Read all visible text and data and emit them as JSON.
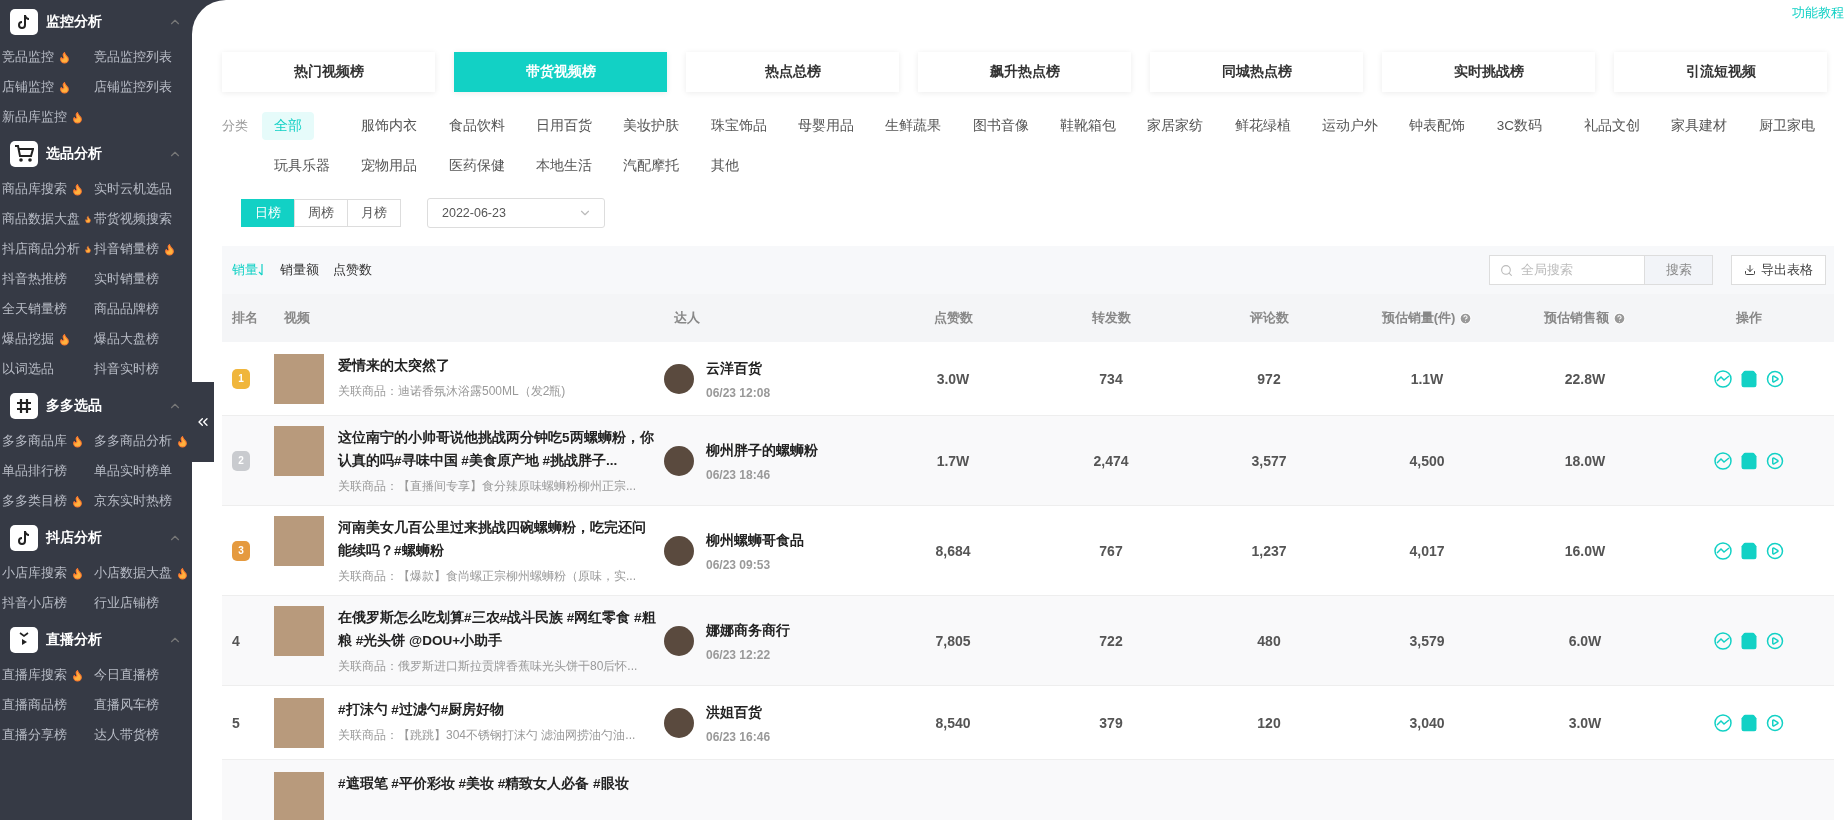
{
  "sidebar": {
    "sections": [
      {
        "title": "监控分析",
        "kind": "tiktok",
        "expanded": true,
        "items": [
          {
            "label": "竞品监控",
            "hot": true
          },
          {
            "label": "竞品监控列表",
            "hot": false
          },
          {
            "label": "店铺监控",
            "hot": true
          },
          {
            "label": "店铺监控列表",
            "hot": false
          },
          {
            "label": "新品库监控",
            "hot": true
          }
        ]
      },
      {
        "title": "选品分析",
        "kind": "cart",
        "expanded": true,
        "items": [
          {
            "label": "商品库搜索",
            "hot": true
          },
          {
            "label": "实时云机选品",
            "hot": false
          },
          {
            "label": "商品数据大盘",
            "hot": true
          },
          {
            "label": "带货视频搜索",
            "hot": false
          },
          {
            "label": "抖店商品分析",
            "hot": true
          },
          {
            "label": "抖音销量榜",
            "hot": true
          },
          {
            "label": "抖音热推榜",
            "hot": false
          },
          {
            "label": "实时销量榜",
            "hot": false
          },
          {
            "label": "全天销量榜",
            "hot": false
          },
          {
            "label": "商品品牌榜",
            "hot": false
          },
          {
            "label": "爆品挖掘",
            "hot": true
          },
          {
            "label": "爆品大盘榜",
            "hot": false
          },
          {
            "label": "以词选品",
            "hot": false
          },
          {
            "label": "抖音实时榜",
            "hot": false
          }
        ]
      },
      {
        "title": "多多选品",
        "kind": "hash",
        "expanded": true,
        "items": [
          {
            "label": "多多商品库",
            "hot": true
          },
          {
            "label": "多多商品分析",
            "hot": true
          },
          {
            "label": "单品排行榜",
            "hot": false
          },
          {
            "label": "单品实时榜单",
            "hot": false
          },
          {
            "label": "多多类目榜",
            "hot": true
          },
          {
            "label": "京东实时热榜",
            "hot": false
          }
        ]
      },
      {
        "title": "抖店分析",
        "kind": "tiktok",
        "expanded": true,
        "items": [
          {
            "label": "小店库搜索",
            "hot": true
          },
          {
            "label": "小店数据大盘",
            "hot": true
          },
          {
            "label": "抖音小店榜",
            "hot": false
          },
          {
            "label": "行业店铺榜",
            "hot": false
          }
        ]
      },
      {
        "title": "直播分析",
        "kind": "tv",
        "expanded": true,
        "items": [
          {
            "label": "直播库搜索",
            "hot": true
          },
          {
            "label": "今日直播榜",
            "hot": false
          },
          {
            "label": "直播商品榜",
            "hot": false
          },
          {
            "label": "直播风车榜",
            "hot": false
          },
          {
            "label": "直播分享榜",
            "hot": false
          },
          {
            "label": "达人带货榜",
            "hot": false
          }
        ]
      }
    ]
  },
  "tutorial_link": "功能教程",
  "rank_tabs": [
    {
      "label": "热门视频榜",
      "selected": false
    },
    {
      "label": "带货视频榜",
      "selected": true
    },
    {
      "label": "热点总榜",
      "selected": false
    },
    {
      "label": "飙升热点榜",
      "selected": false
    },
    {
      "label": "同城热点榜",
      "selected": false
    },
    {
      "label": "实时挑战榜",
      "selected": false
    },
    {
      "label": "引流短视频",
      "selected": false
    }
  ],
  "category_label": "分类",
  "categories": [
    {
      "label": "全部",
      "selected": true
    },
    {
      "label": "服饰内衣",
      "selected": false
    },
    {
      "label": "食品饮料",
      "selected": false
    },
    {
      "label": "日用百货",
      "selected": false
    },
    {
      "label": "美妆护肤",
      "selected": false
    },
    {
      "label": "珠宝饰品",
      "selected": false
    },
    {
      "label": "母婴用品",
      "selected": false
    },
    {
      "label": "生鲜蔬果",
      "selected": false
    },
    {
      "label": "图书音像",
      "selected": false
    },
    {
      "label": "鞋靴箱包",
      "selected": false
    },
    {
      "label": "家居家纺",
      "selected": false
    },
    {
      "label": "鲜花绿植",
      "selected": false
    },
    {
      "label": "运动户外",
      "selected": false
    },
    {
      "label": "钟表配饰",
      "selected": false
    },
    {
      "label": "3C数码",
      "selected": false
    },
    {
      "label": "礼品文创",
      "selected": false
    },
    {
      "label": "家具建材",
      "selected": false
    },
    {
      "label": "厨卫家电",
      "selected": false
    },
    {
      "label": "玩具乐器",
      "selected": false
    },
    {
      "label": "宠物用品",
      "selected": false
    },
    {
      "label": "医药保健",
      "selected": false
    },
    {
      "label": "本地生活",
      "selected": false
    },
    {
      "label": "汽配摩托",
      "selected": false
    },
    {
      "label": "其他",
      "selected": false
    }
  ],
  "periods": [
    {
      "label": "日榜",
      "selected": true
    },
    {
      "label": "周榜",
      "selected": false
    },
    {
      "label": "月榜",
      "selected": false
    }
  ],
  "date": "2022-06-23",
  "sorts": [
    {
      "label": "销量",
      "selected": true
    },
    {
      "label": "销量额",
      "selected": false
    },
    {
      "label": "点赞数",
      "selected": false
    }
  ],
  "search": {
    "placeholder": "全局搜索",
    "button": "搜索"
  },
  "export_button": "导出表格",
  "table": {
    "columns": [
      {
        "label": "排名",
        "help": false
      },
      {
        "label": "视频",
        "help": false
      },
      {
        "label": "达人",
        "help": false
      },
      {
        "label": "点赞数",
        "help": false
      },
      {
        "label": "转发数",
        "help": false
      },
      {
        "label": "评论数",
        "help": false
      },
      {
        "label": "预估销量(件)",
        "help": true
      },
      {
        "label": "预估销售额",
        "help": true
      },
      {
        "label": "操作",
        "help": false
      }
    ],
    "rows": [
      {
        "rank": {
          "kind": "medal",
          "text": "1",
          "color": "#f0b63c"
        },
        "title": "爱情来的太突然了",
        "product": "关联商品：迪诺香氛沐浴露500ML（发2瓶)",
        "creator": "云洋百货",
        "time": "06/23 12:08",
        "likes": "3.0W",
        "shares": "734",
        "comments": "972",
        "sales": "1.1W",
        "revenue": "22.8W"
      },
      {
        "rank": {
          "kind": "medal",
          "text": "2",
          "color": "#c9cbcf"
        },
        "title": "这位南宁的小帅哥说他挑战两分钟吃5两螺蛳粉，你认真的吗#寻味中国 #美食原产地 #挑战胖子...",
        "product": "关联商品：【直播间专享】食分辣原味螺蛳粉柳州正宗...",
        "creator": "柳州胖子的螺蛳粉",
        "time": "06/23 18:46",
        "likes": "1.7W",
        "shares": "2,474",
        "comments": "3,577",
        "sales": "4,500",
        "revenue": "18.0W"
      },
      {
        "rank": {
          "kind": "medal",
          "text": "3",
          "color": "#e59a3f"
        },
        "title": "河南美女几百公里过来挑战四碗螺蛳粉，吃完还问能续吗？#螺蛳粉",
        "product": "关联商品：【爆款】食尚螺正宗柳州螺蛳粉（原味，实...",
        "creator": "柳州螺蛳哥食品",
        "time": "06/23 09:53",
        "likes": "8,684",
        "shares": "767",
        "comments": "1,237",
        "sales": "4,017",
        "revenue": "16.0W"
      },
      {
        "rank": {
          "kind": "number",
          "text": "4"
        },
        "title": "在俄罗斯怎么吃划算#三农#战斗民族 #网红零食 #粗粮 #光头饼 @DOU+小助手",
        "product": "关联商品：俄罗斯进口斯拉贡牌香蕉味光头饼干80后怀...",
        "creator": "娜娜商务商行",
        "time": "06/23 12:22",
        "likes": "7,805",
        "shares": "722",
        "comments": "480",
        "sales": "3,579",
        "revenue": "6.0W"
      },
      {
        "rank": {
          "kind": "number",
          "text": "5"
        },
        "title": "#打沫勺 #过滤勺#厨房好物",
        "product": "关联商品：【跳跳】304不锈钢打沫勺 滤油网捞油勺油...",
        "creator": "洪姐百货",
        "time": "06/23 16:46",
        "likes": "8,540",
        "shares": "379",
        "comments": "120",
        "sales": "3,040",
        "revenue": "3.0W"
      },
      {
        "rank": {
          "kind": "blank"
        },
        "title": "#遮瑕笔 #平价彩妆 #美妆 #精致女人必备 #眼妆"
      }
    ]
  }
}
